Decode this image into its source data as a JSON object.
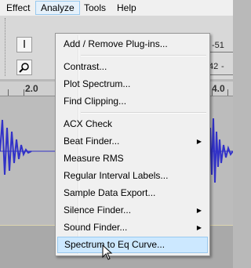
{
  "menubar": {
    "items": [
      "Effect",
      "Analyze",
      "Tools",
      "Help"
    ],
    "open_index": 1
  },
  "toolbar": {
    "meter_top_label": "-51",
    "meter_bottom_label": "42",
    "meter_bottom_suffix": "-"
  },
  "ruler": {
    "left_label": "2.0",
    "right_label": "4.0"
  },
  "analyze_menu": {
    "groups": [
      [
        {
          "label": "Add / Remove Plug-ins...",
          "submenu": false
        }
      ],
      [
        {
          "label": "Contrast...",
          "submenu": false
        },
        {
          "label": "Plot Spectrum...",
          "submenu": false
        },
        {
          "label": "Find Clipping...",
          "submenu": false
        }
      ],
      [
        {
          "label": "ACX Check",
          "submenu": false
        },
        {
          "label": "Beat Finder...",
          "submenu": true
        },
        {
          "label": "Measure RMS",
          "submenu": false
        },
        {
          "label": "Regular Interval Labels...",
          "submenu": false
        },
        {
          "label": "Sample Data Export...",
          "submenu": false
        },
        {
          "label": "Silence Finder...",
          "submenu": true
        },
        {
          "label": "Sound Finder...",
          "submenu": true
        },
        {
          "label": "Spectrum to Eq Curve...",
          "submenu": false
        }
      ]
    ],
    "highlighted": "Spectrum to Eq Curve..."
  },
  "colors": {
    "waveform": "#3232c8",
    "highlight": "#cce8ff",
    "menubar_open": "#e5f1fb"
  },
  "icons": [
    "ibeam-icon",
    "zoom-icon",
    "submenu-arrow-icon",
    "mouse-pointer-icon"
  ]
}
